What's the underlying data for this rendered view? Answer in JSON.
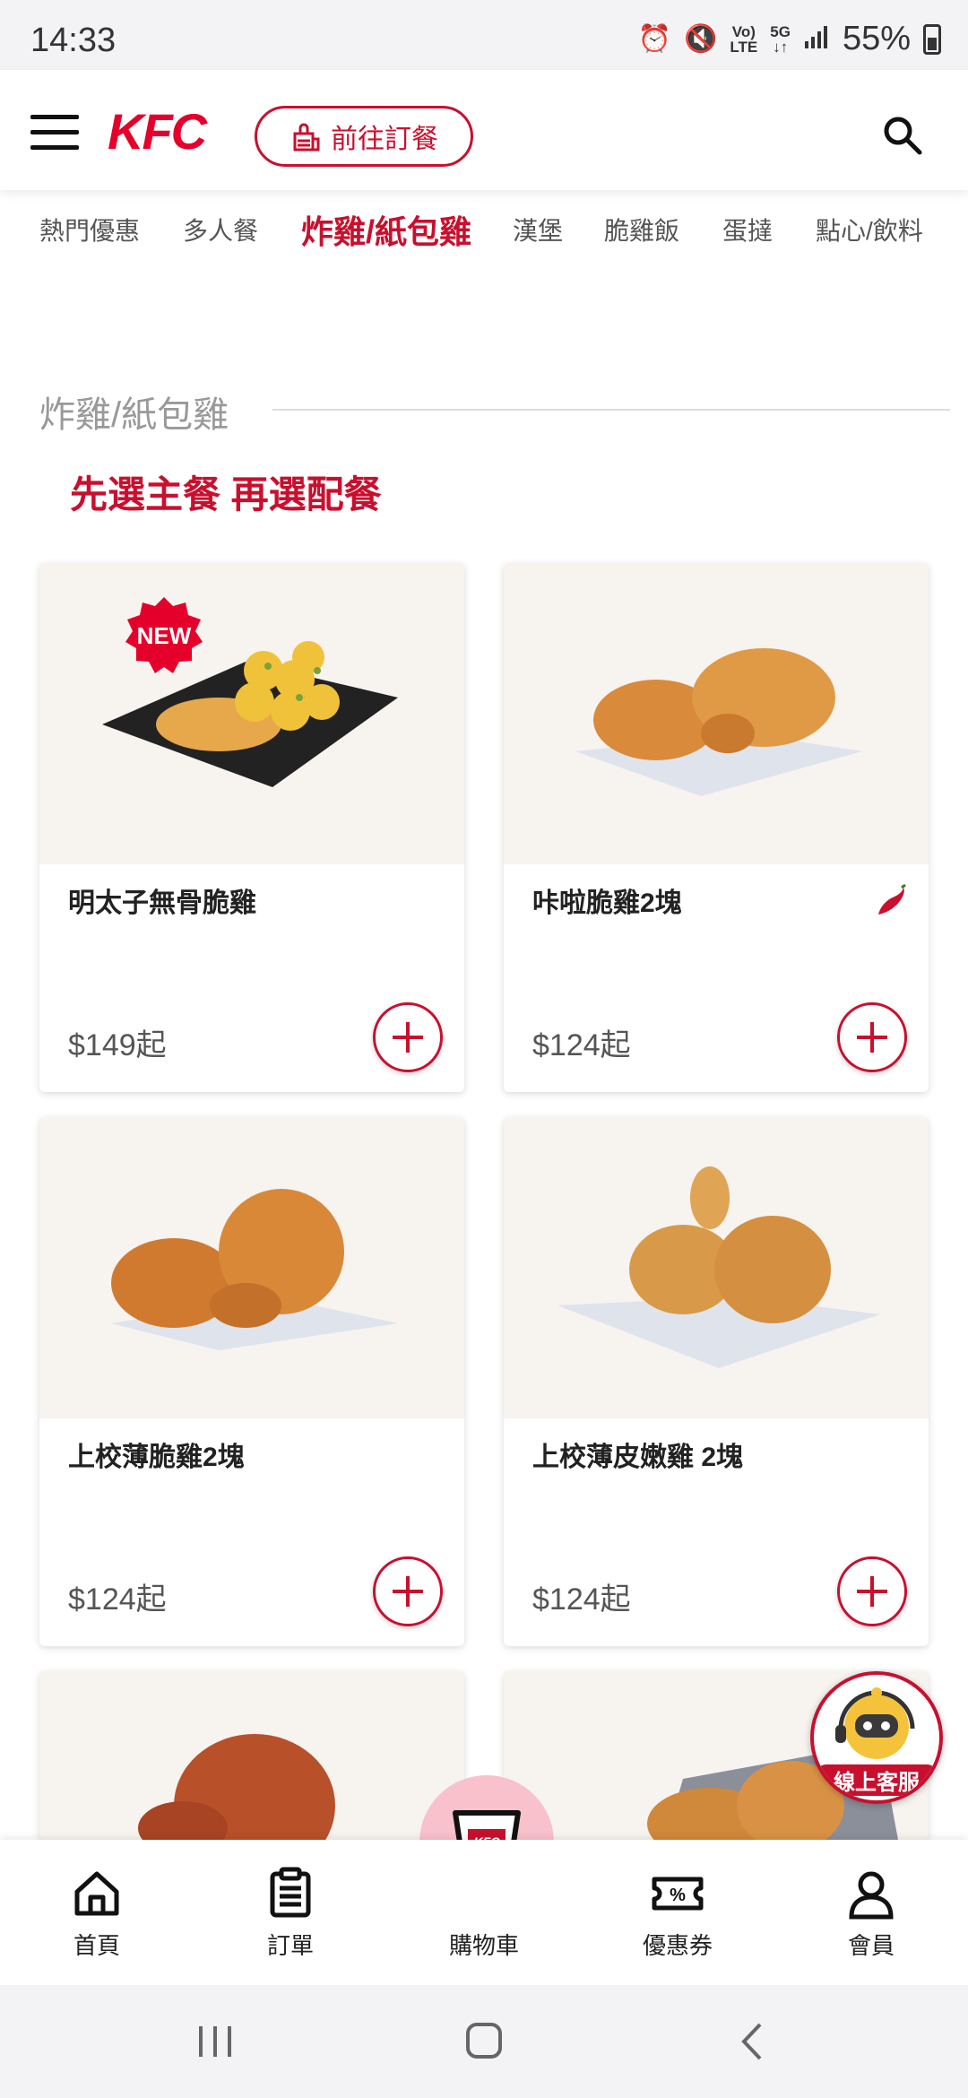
{
  "status_bar": {
    "time": "14:33",
    "network_top": "Vo)",
    "network_bottom": "LTE",
    "gen_top": "5G",
    "gen_bottom": "↓↑",
    "battery": "55%"
  },
  "header": {
    "logo": "KFC",
    "order_button": "前往訂餐"
  },
  "tabs": [
    "熱門優惠",
    "多人餐",
    "炸雞/紙包雞",
    "漢堡",
    "脆雞飯",
    "蛋撻",
    "點心/飲料"
  ],
  "active_tab": "炸雞/紙包雞",
  "section": {
    "title": "炸雞/紙包雞",
    "promo": "先選主餐 再選配餐"
  },
  "products": [
    {
      "name": "明太子無骨脆雞",
      "price": "$149起",
      "badge": "NEW",
      "spicy": false
    },
    {
      "name": "咔啦脆雞2塊",
      "price": "$124起",
      "badge": "",
      "spicy": true
    },
    {
      "name": "上校薄脆雞2塊",
      "price": "$124起",
      "badge": "",
      "spicy": false
    },
    {
      "name": "上校薄皮嫩雞 2塊",
      "price": "$124起",
      "badge": "",
      "spicy": false
    }
  ],
  "customer_service": {
    "label": "線上客服"
  },
  "bottom_nav": [
    {
      "label": "首頁",
      "icon": "home-icon"
    },
    {
      "label": "訂單",
      "icon": "order-list-icon"
    },
    {
      "label": "購物車",
      "icon": "kfc-bucket-icon"
    },
    {
      "label": "優惠券",
      "icon": "coupon-icon"
    },
    {
      "label": "會員",
      "icon": "user-icon"
    }
  ],
  "colors": {
    "brand_red": "#c8102e",
    "cart_pink": "#f8c1cc"
  }
}
